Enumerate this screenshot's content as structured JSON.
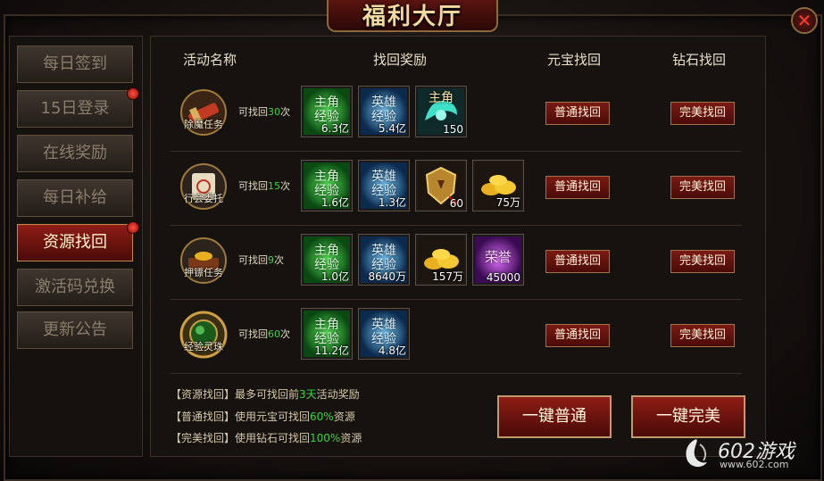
{
  "window": {
    "title": "福利大厅",
    "close_label": "✕"
  },
  "sidebar": {
    "items": [
      {
        "label": "每日签到",
        "active": false,
        "dot": false
      },
      {
        "label": "15日登录",
        "active": false,
        "dot": true
      },
      {
        "label": "在线奖励",
        "active": false,
        "dot": false
      },
      {
        "label": "每日补给",
        "active": false,
        "dot": false
      },
      {
        "label": "资源找回",
        "active": true,
        "dot": true
      },
      {
        "label": "激活码兑换",
        "active": false,
        "dot": false
      },
      {
        "label": "更新公告",
        "active": false,
        "dot": false
      }
    ]
  },
  "table": {
    "headers": {
      "name": "活动名称",
      "reward": "找回奖励",
      "gold": "元宝找回",
      "diamond": "钻石找回"
    },
    "rows": [
      {
        "name": "除魔任务",
        "count_prefix": "可找回",
        "count": "30",
        "count_suffix": "次",
        "rewards": [
          {
            "kind": "green",
            "line1": "主角",
            "line2": "经验",
            "amount": "6.3亿"
          },
          {
            "kind": "blue",
            "line1": "英雄",
            "line2": "经验",
            "amount": "5.4亿"
          },
          {
            "kind": "wing",
            "line1": "主角",
            "line2": "",
            "amount": "150"
          }
        ],
        "normal_label": "普通找回",
        "perfect_label": "完美找回"
      },
      {
        "name": "行会委托",
        "count_prefix": "可找回",
        "count": "15",
        "count_suffix": "次",
        "rewards": [
          {
            "kind": "green",
            "line1": "主角",
            "line2": "经验",
            "amount": "1.6亿"
          },
          {
            "kind": "blue",
            "line1": "英雄",
            "line2": "经验",
            "amount": "1.3亿"
          },
          {
            "kind": "shield",
            "line1": "",
            "line2": "",
            "amount": "60"
          },
          {
            "kind": "gold",
            "line1": "",
            "line2": "",
            "amount": "75万"
          }
        ],
        "normal_label": "普通找回",
        "perfect_label": "完美找回"
      },
      {
        "name": "押镖任务",
        "count_prefix": "可找回",
        "count": "9",
        "count_suffix": "次",
        "rewards": [
          {
            "kind": "green",
            "line1": "主角",
            "line2": "经验",
            "amount": "1.0亿"
          },
          {
            "kind": "blue",
            "line1": "英雄",
            "line2": "经验",
            "amount": "8640万"
          },
          {
            "kind": "gold",
            "line1": "",
            "line2": "",
            "amount": "157万"
          },
          {
            "kind": "purple",
            "line1": "荣誉",
            "line2": "",
            "amount": "45000"
          }
        ],
        "normal_label": "普通找回",
        "perfect_label": "完美找回"
      },
      {
        "name": "经验灵珠",
        "count_prefix": "可找回",
        "count": "60",
        "count_suffix": "次",
        "rewards": [
          {
            "kind": "green",
            "line1": "主角",
            "line2": "经验",
            "amount": "11.2亿"
          },
          {
            "kind": "blue",
            "line1": "英雄",
            "line2": "经验",
            "amount": "4.8亿"
          }
        ],
        "normal_label": "普通找回",
        "perfect_label": "完美找回"
      }
    ]
  },
  "notes": [
    {
      "prefix": "【资源找回】最多可找回前",
      "highlight": "3天",
      "suffix": "活动奖励"
    },
    {
      "prefix": "【普通找回】使用元宝可找回",
      "highlight": "60%",
      "suffix": "资源"
    },
    {
      "prefix": "【完美找回】使用钻石可找回",
      "highlight": "100%",
      "suffix": "资源"
    }
  ],
  "buttons": {
    "all_normal": "一键普通",
    "all_perfect": "一键完美"
  },
  "watermark": {
    "brand": "602游戏",
    "url": "www.602.com"
  },
  "colors": {
    "accent_red": "#8e1d16",
    "highlight_green": "#3dd43d",
    "gold_text": "#f2d9a0"
  }
}
